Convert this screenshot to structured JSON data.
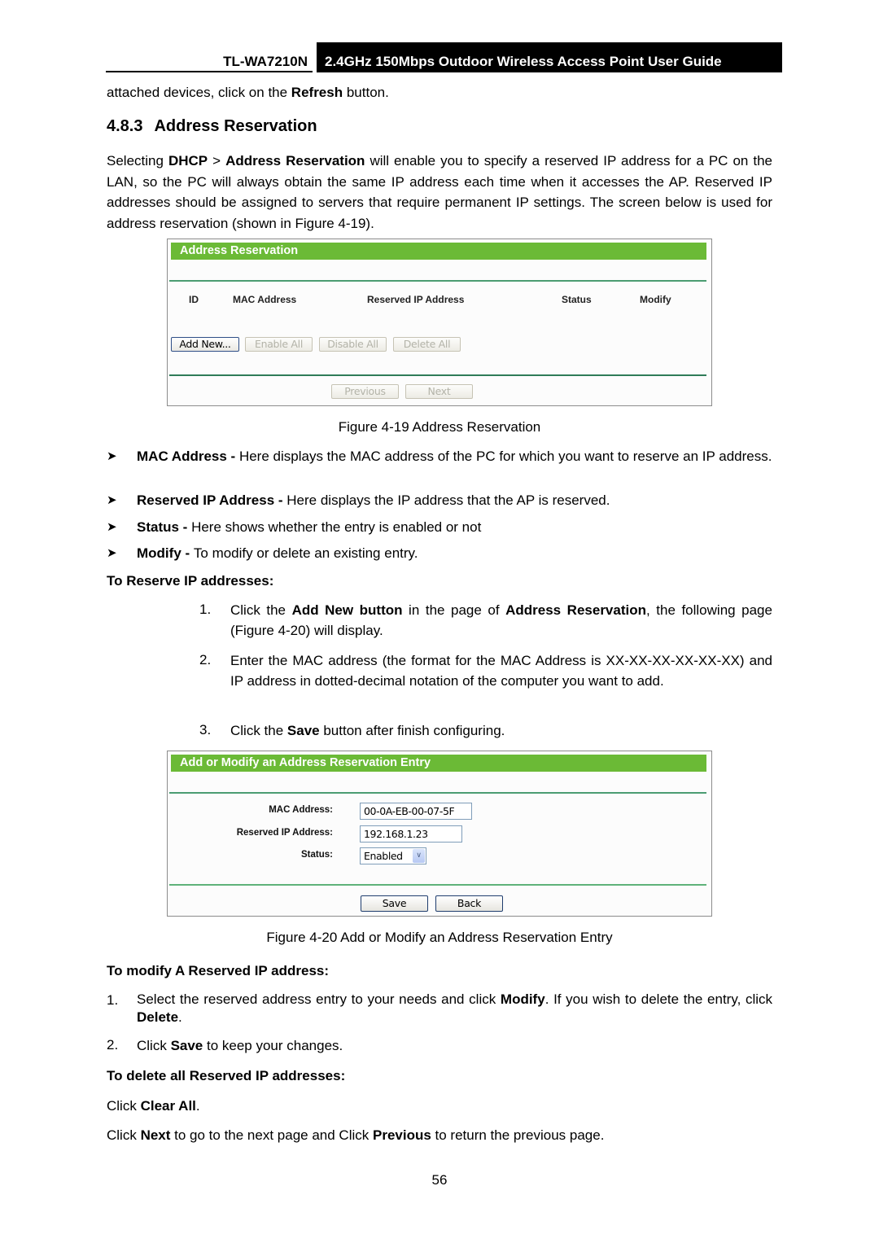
{
  "header": {
    "model": "TL-WA7210N",
    "guide_title": "2.4GHz 150Mbps Outdoor Wireless Access Point User Guide"
  },
  "intro_line": {
    "pre": "attached devices, click on the ",
    "bold": "Refresh",
    "post": " button."
  },
  "section": {
    "number": "4.8.3",
    "title": "Address Reservation"
  },
  "para1": {
    "t1": "Selecting ",
    "b1": "DHCP",
    "t2": " > ",
    "b2": "Address Reservation",
    "t3": " will enable you to specify a reserved IP address for a PC on the LAN, so the PC will always obtain the same IP address each time when it accesses the AP. Reserved IP addresses should be assigned to servers that require permanent IP settings. The screen below is used for address reservation (shown in Figure 4-19)."
  },
  "figure19": {
    "panel_title": "Address Reservation",
    "columns": [
      "ID",
      "MAC Address",
      "Reserved IP Address",
      "Status",
      "Modify"
    ],
    "buttons": {
      "add_new": "Add New...",
      "enable_all": "Enable All",
      "disable_all": "Disable All",
      "delete_all": "Delete All",
      "previous": "Previous",
      "next": "Next"
    },
    "caption": "Figure 4-19 Address Reservation"
  },
  "bullets": [
    {
      "term": "MAC Address - ",
      "desc": "Here displays the MAC address of the PC for which you want to reserve an IP address."
    },
    {
      "term": "Reserved IP Address - ",
      "desc": "Here displays the IP address that the AP is reserved."
    },
    {
      "term": "Status - ",
      "desc": "Here shows whether the entry is enabled or not"
    },
    {
      "term": "Modify - ",
      "desc": "To modify or delete an existing entry."
    }
  ],
  "reserve_heading": "To Reserve IP addresses:",
  "reserve_steps": [
    {
      "n": "1.",
      "t1": "Click the ",
      "b1": "Add New button",
      "t2": " in the page of ",
      "b2": "Address Reservation",
      "t3": ", the following page (Figure 4-20) will display."
    },
    {
      "n": "2.",
      "t1": "Enter the MAC address (the format for the MAC Address is XX-XX-XX-XX-XX-XX) and IP address in dotted-decimal notation of the computer you want to add."
    },
    {
      "n": "3.",
      "t1": "Click the ",
      "b1": "Save",
      "t2": " button after finish configuring."
    }
  ],
  "figure20": {
    "panel_title": "Add or Modify an Address Reservation Entry",
    "fields": {
      "mac_label": "MAC Address:",
      "mac_value": "00-0A-EB-00-07-5F",
      "ip_label": "Reserved IP Address:",
      "ip_value": "192.168.1.23",
      "status_label": "Status:",
      "status_value": "Enabled"
    },
    "buttons": {
      "save": "Save",
      "back": "Back"
    },
    "caption": "Figure 4-20 Add or Modify an Address Reservation Entry"
  },
  "modify_heading": "To modify A Reserved IP address:",
  "modify_steps": [
    {
      "n": "1.",
      "t1": "Select the reserved address entry to your needs and click ",
      "b1": "Modify",
      "t2": ". If you wish to delete the entry, click ",
      "b2": "Delete",
      "t3": "."
    },
    {
      "n": "2.",
      "t1": "Click ",
      "b1": "Save",
      "t2": " to keep your changes."
    }
  ],
  "delete_heading": "To delete all Reserved IP addresses:",
  "clear_line": {
    "t1": "Click ",
    "b1": "Clear All",
    "t2": "."
  },
  "nav_line": {
    "t1": "Click ",
    "b1": "Next",
    "t2": " to go to the next page and Click ",
    "b2": "Previous",
    "t3": " to return the previous page."
  },
  "page_number": "56"
}
